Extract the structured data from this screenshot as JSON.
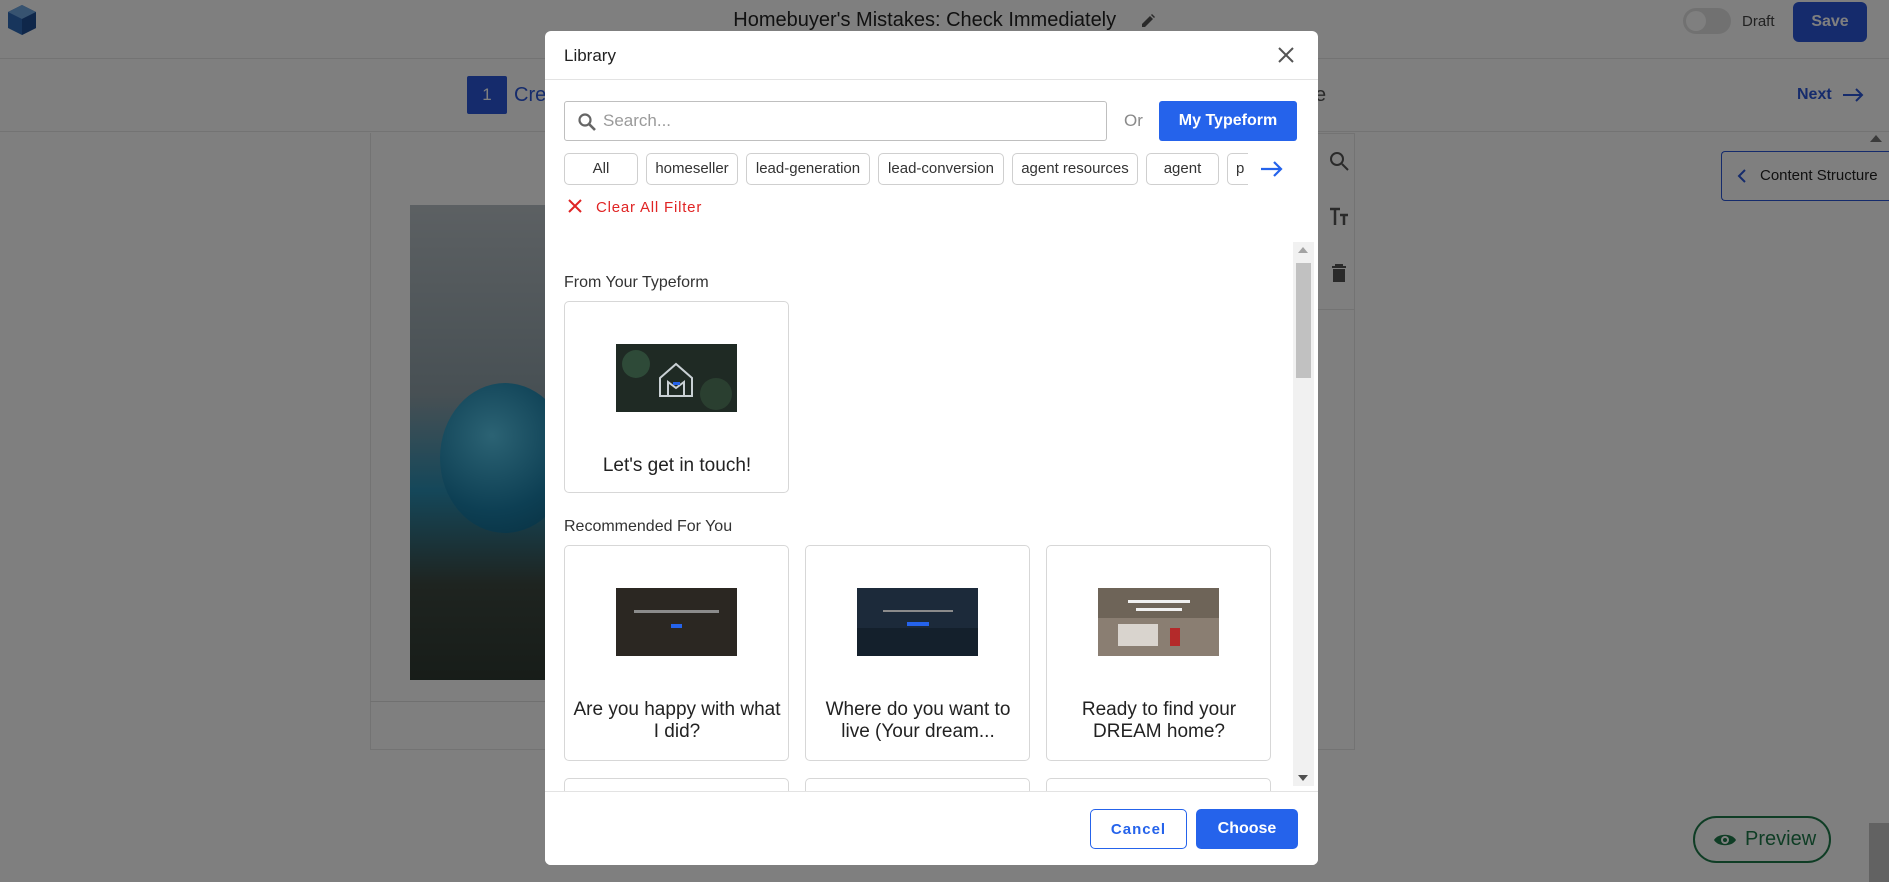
{
  "app": {
    "doc_title": "Homebuyer's Mistakes: Check Immediately",
    "draft_label": "Draft",
    "save_label": "Save",
    "step_number": "1",
    "step_label": "Cre",
    "step_tail": "e",
    "next_label": "Next",
    "content_structure_label": "Content Structure",
    "preview_label": "Preview",
    "accent_color": "#2a57d8",
    "preview_color": "#1e7a4a"
  },
  "modal": {
    "title": "Library",
    "search": {
      "placeholder": "Search...",
      "value": ""
    },
    "or_text": "Or",
    "my_typeform_label": "My Typeform",
    "tags": [
      "All",
      "homeseller",
      "lead-generation",
      "lead-conversion",
      "agent resources",
      "agent",
      "p"
    ],
    "clear_filter_label": "Clear All Filter",
    "sections": [
      {
        "title": "From Your Typeform",
        "items": [
          {
            "label": "Let's get in touch!",
            "thumb": "dark-house-logo"
          }
        ]
      },
      {
        "title": "Recommended For You",
        "items": [
          {
            "label": "Are you happy with what I did?",
            "thumb": "dark-thank-you"
          },
          {
            "label": "Where do you want to live (Your dream...",
            "thumb": "city-blue"
          },
          {
            "label": "Ready to find your DREAM home?",
            "thumb": "laptop-house"
          }
        ]
      }
    ],
    "cancel_label": "Cancel",
    "choose_label": "Choose",
    "primary_color": "#2563eb",
    "danger_color": "#e02424"
  }
}
